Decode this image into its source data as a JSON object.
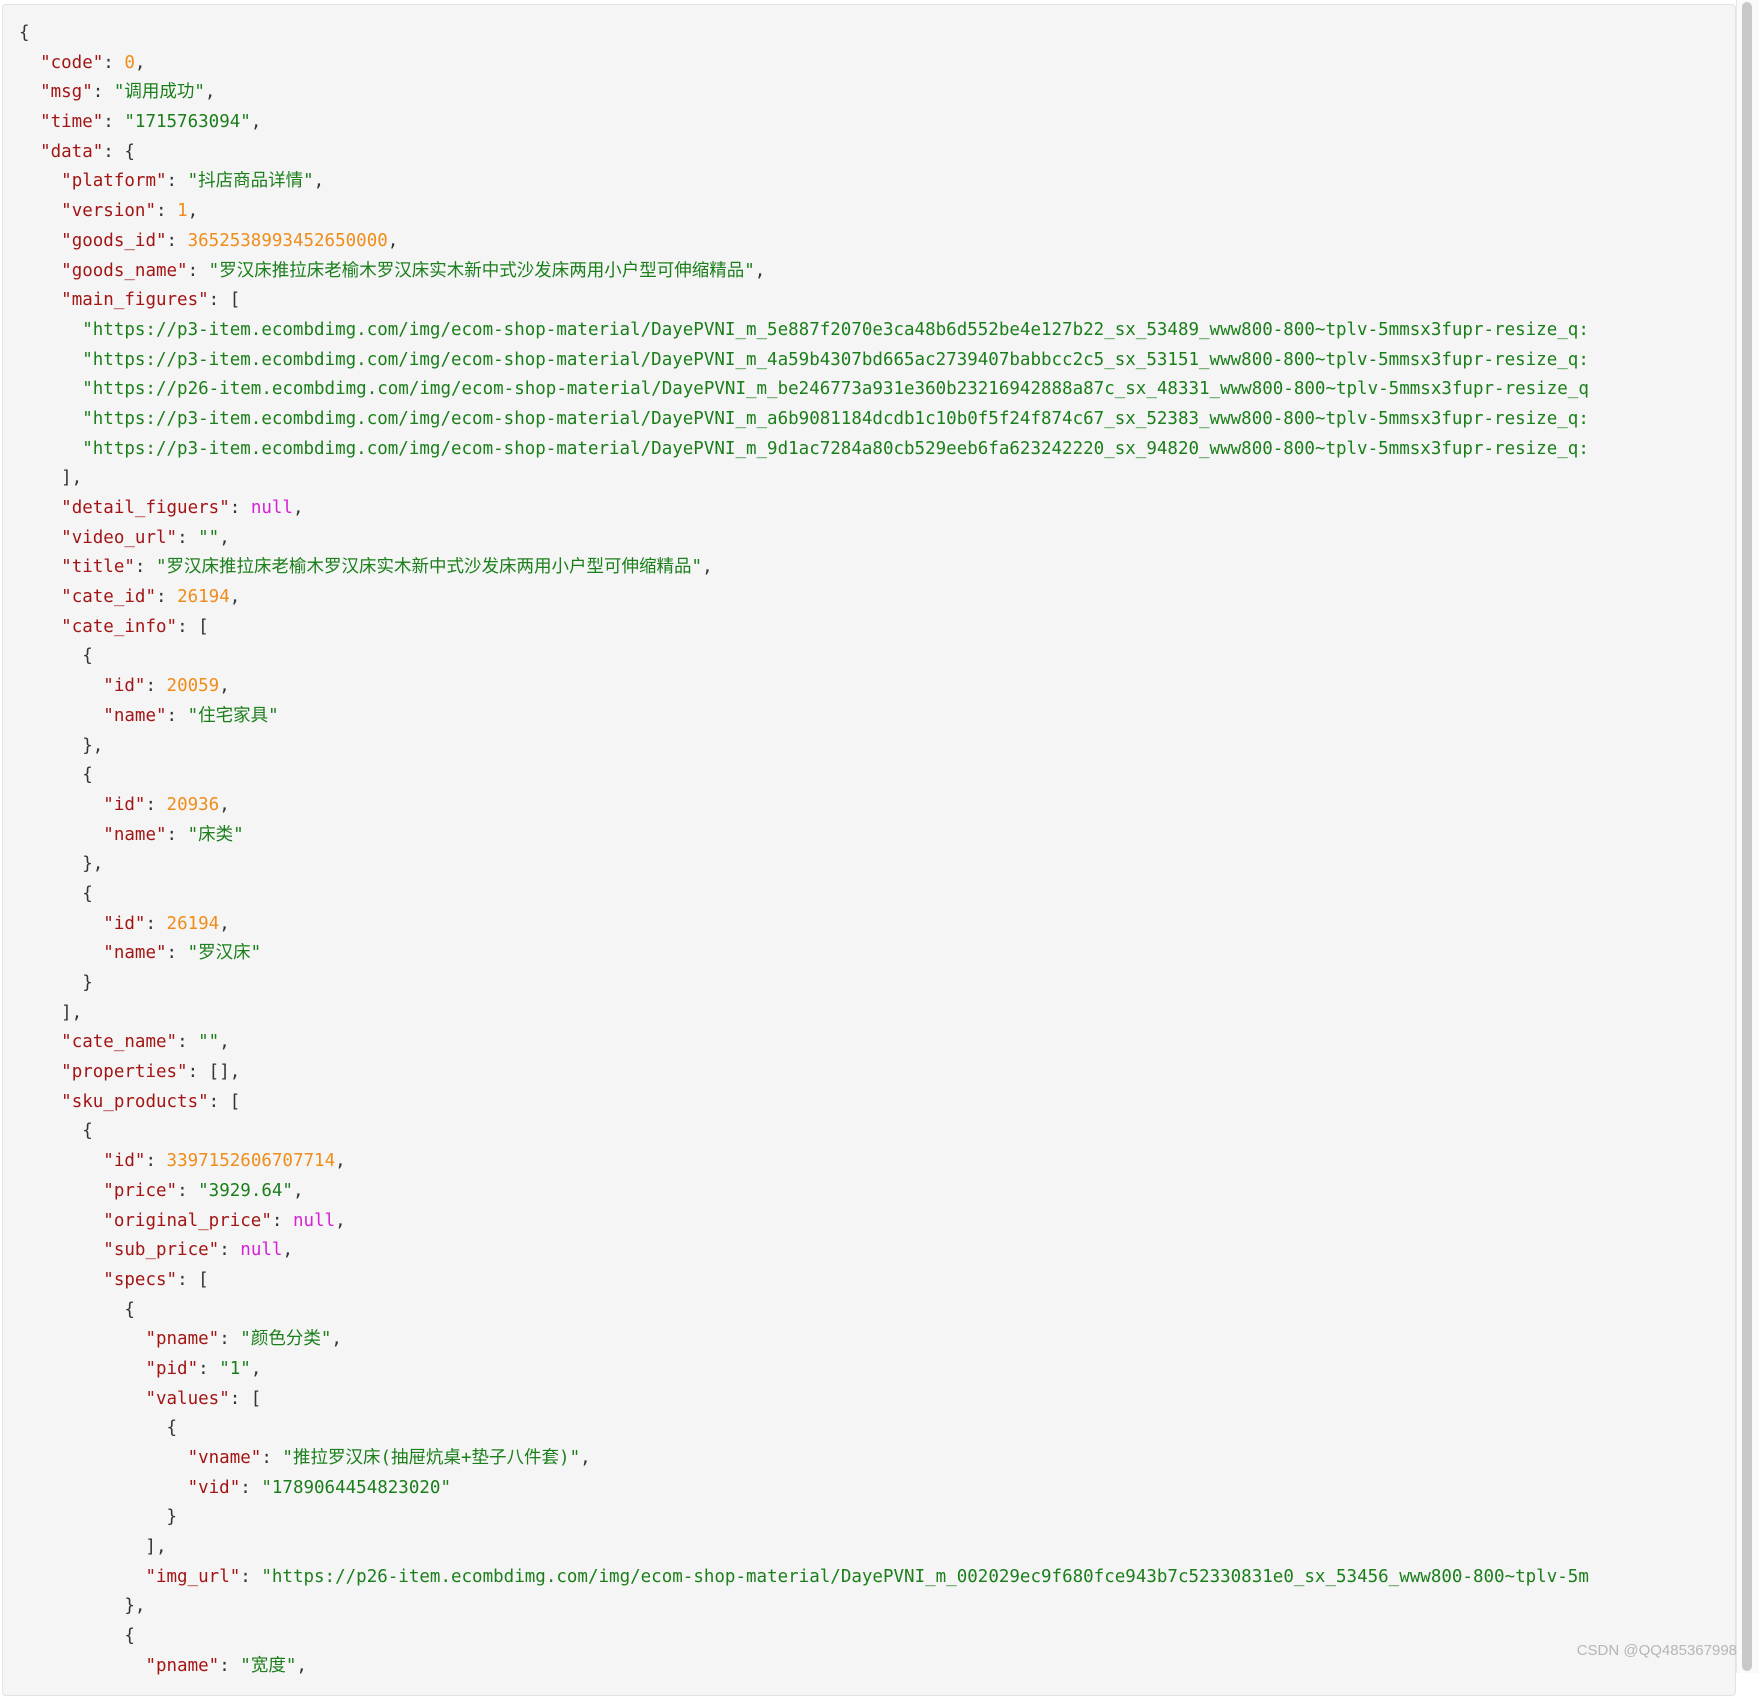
{
  "lines": [
    [
      {
        "t": "p",
        "v": "{"
      }
    ],
    [
      {
        "t": "p",
        "v": "  "
      },
      {
        "t": "k",
        "v": "\"code\""
      },
      {
        "t": "p",
        "v": ": "
      },
      {
        "t": "n",
        "v": "0"
      },
      {
        "t": "p",
        "v": ","
      }
    ],
    [
      {
        "t": "p",
        "v": "  "
      },
      {
        "t": "k",
        "v": "\"msg\""
      },
      {
        "t": "p",
        "v": ": "
      },
      {
        "t": "s",
        "v": "\"调用成功\""
      },
      {
        "t": "p",
        "v": ","
      }
    ],
    [
      {
        "t": "p",
        "v": "  "
      },
      {
        "t": "k",
        "v": "\"time\""
      },
      {
        "t": "p",
        "v": ": "
      },
      {
        "t": "s",
        "v": "\"1715763094\""
      },
      {
        "t": "p",
        "v": ","
      }
    ],
    [
      {
        "t": "p",
        "v": "  "
      },
      {
        "t": "k",
        "v": "\"data\""
      },
      {
        "t": "p",
        "v": ": {"
      }
    ],
    [
      {
        "t": "p",
        "v": "    "
      },
      {
        "t": "k",
        "v": "\"platform\""
      },
      {
        "t": "p",
        "v": ": "
      },
      {
        "t": "s",
        "v": "\"抖店商品详情\""
      },
      {
        "t": "p",
        "v": ","
      }
    ],
    [
      {
        "t": "p",
        "v": "    "
      },
      {
        "t": "k",
        "v": "\"version\""
      },
      {
        "t": "p",
        "v": ": "
      },
      {
        "t": "n",
        "v": "1"
      },
      {
        "t": "p",
        "v": ","
      }
    ],
    [
      {
        "t": "p",
        "v": "    "
      },
      {
        "t": "k",
        "v": "\"goods_id\""
      },
      {
        "t": "p",
        "v": ": "
      },
      {
        "t": "n",
        "v": "3652538993452650000"
      },
      {
        "t": "p",
        "v": ","
      }
    ],
    [
      {
        "t": "p",
        "v": "    "
      },
      {
        "t": "k",
        "v": "\"goods_name\""
      },
      {
        "t": "p",
        "v": ": "
      },
      {
        "t": "s",
        "v": "\"罗汉床推拉床老榆木罗汉床实木新中式沙发床两用小户型可伸缩精品\""
      },
      {
        "t": "p",
        "v": ","
      }
    ],
    [
      {
        "t": "p",
        "v": "    "
      },
      {
        "t": "k",
        "v": "\"main_figures\""
      },
      {
        "t": "p",
        "v": ": ["
      }
    ],
    [
      {
        "t": "p",
        "v": "      "
      },
      {
        "t": "s",
        "v": "\"https://p3-item.ecombdimg.com/img/ecom-shop-material/DayePVNI_m_5e887f2070e3ca48b6d552be4e127b22_sx_53489_www800-800~tplv-5mmsx3fupr-resize_q:"
      }
    ],
    [
      {
        "t": "p",
        "v": "      "
      },
      {
        "t": "s",
        "v": "\"https://p3-item.ecombdimg.com/img/ecom-shop-material/DayePVNI_m_4a59b4307bd665ac2739407babbcc2c5_sx_53151_www800-800~tplv-5mmsx3fupr-resize_q:"
      }
    ],
    [
      {
        "t": "p",
        "v": "      "
      },
      {
        "t": "s",
        "v": "\"https://p26-item.ecombdimg.com/img/ecom-shop-material/DayePVNI_m_be246773a931e360b23216942888a87c_sx_48331_www800-800~tplv-5mmsx3fupr-resize_q"
      }
    ],
    [
      {
        "t": "p",
        "v": "      "
      },
      {
        "t": "s",
        "v": "\"https://p3-item.ecombdimg.com/img/ecom-shop-material/DayePVNI_m_a6b9081184dcdb1c10b0f5f24f874c67_sx_52383_www800-800~tplv-5mmsx3fupr-resize_q:"
      }
    ],
    [
      {
        "t": "p",
        "v": "      "
      },
      {
        "t": "s",
        "v": "\"https://p3-item.ecombdimg.com/img/ecom-shop-material/DayePVNI_m_9d1ac7284a80cb529eeb6fa623242220_sx_94820_www800-800~tplv-5mmsx3fupr-resize_q:"
      }
    ],
    [
      {
        "t": "p",
        "v": "    ],"
      }
    ],
    [
      {
        "t": "p",
        "v": "    "
      },
      {
        "t": "k",
        "v": "\"detail_figuers\""
      },
      {
        "t": "p",
        "v": ": "
      },
      {
        "t": "l",
        "v": "null"
      },
      {
        "t": "p",
        "v": ","
      }
    ],
    [
      {
        "t": "p",
        "v": "    "
      },
      {
        "t": "k",
        "v": "\"video_url\""
      },
      {
        "t": "p",
        "v": ": "
      },
      {
        "t": "s",
        "v": "\"\""
      },
      {
        "t": "p",
        "v": ","
      }
    ],
    [
      {
        "t": "p",
        "v": "    "
      },
      {
        "t": "k",
        "v": "\"title\""
      },
      {
        "t": "p",
        "v": ": "
      },
      {
        "t": "s",
        "v": "\"罗汉床推拉床老榆木罗汉床实木新中式沙发床两用小户型可伸缩精品\""
      },
      {
        "t": "p",
        "v": ","
      }
    ],
    [
      {
        "t": "p",
        "v": "    "
      },
      {
        "t": "k",
        "v": "\"cate_id\""
      },
      {
        "t": "p",
        "v": ": "
      },
      {
        "t": "n",
        "v": "26194"
      },
      {
        "t": "p",
        "v": ","
      }
    ],
    [
      {
        "t": "p",
        "v": "    "
      },
      {
        "t": "k",
        "v": "\"cate_info\""
      },
      {
        "t": "p",
        "v": ": ["
      }
    ],
    [
      {
        "t": "p",
        "v": "      {"
      }
    ],
    [
      {
        "t": "p",
        "v": "        "
      },
      {
        "t": "k",
        "v": "\"id\""
      },
      {
        "t": "p",
        "v": ": "
      },
      {
        "t": "n",
        "v": "20059"
      },
      {
        "t": "p",
        "v": ","
      }
    ],
    [
      {
        "t": "p",
        "v": "        "
      },
      {
        "t": "k",
        "v": "\"name\""
      },
      {
        "t": "p",
        "v": ": "
      },
      {
        "t": "s",
        "v": "\"住宅家具\""
      }
    ],
    [
      {
        "t": "p",
        "v": "      },"
      }
    ],
    [
      {
        "t": "p",
        "v": "      {"
      }
    ],
    [
      {
        "t": "p",
        "v": "        "
      },
      {
        "t": "k",
        "v": "\"id\""
      },
      {
        "t": "p",
        "v": ": "
      },
      {
        "t": "n",
        "v": "20936"
      },
      {
        "t": "p",
        "v": ","
      }
    ],
    [
      {
        "t": "p",
        "v": "        "
      },
      {
        "t": "k",
        "v": "\"name\""
      },
      {
        "t": "p",
        "v": ": "
      },
      {
        "t": "s",
        "v": "\"床类\""
      }
    ],
    [
      {
        "t": "p",
        "v": "      },"
      }
    ],
    [
      {
        "t": "p",
        "v": "      {"
      }
    ],
    [
      {
        "t": "p",
        "v": "        "
      },
      {
        "t": "k",
        "v": "\"id\""
      },
      {
        "t": "p",
        "v": ": "
      },
      {
        "t": "n",
        "v": "26194"
      },
      {
        "t": "p",
        "v": ","
      }
    ],
    [
      {
        "t": "p",
        "v": "        "
      },
      {
        "t": "k",
        "v": "\"name\""
      },
      {
        "t": "p",
        "v": ": "
      },
      {
        "t": "s",
        "v": "\"罗汉床\""
      }
    ],
    [
      {
        "t": "p",
        "v": "      }"
      }
    ],
    [
      {
        "t": "p",
        "v": "    ],"
      }
    ],
    [
      {
        "t": "p",
        "v": "    "
      },
      {
        "t": "k",
        "v": "\"cate_name\""
      },
      {
        "t": "p",
        "v": ": "
      },
      {
        "t": "s",
        "v": "\"\""
      },
      {
        "t": "p",
        "v": ","
      }
    ],
    [
      {
        "t": "p",
        "v": "    "
      },
      {
        "t": "k",
        "v": "\"properties\""
      },
      {
        "t": "p",
        "v": ": [],"
      }
    ],
    [
      {
        "t": "p",
        "v": "    "
      },
      {
        "t": "k",
        "v": "\"sku_products\""
      },
      {
        "t": "p",
        "v": ": ["
      }
    ],
    [
      {
        "t": "p",
        "v": "      {"
      }
    ],
    [
      {
        "t": "p",
        "v": "        "
      },
      {
        "t": "k",
        "v": "\"id\""
      },
      {
        "t": "p",
        "v": ": "
      },
      {
        "t": "n",
        "v": "3397152606707714"
      },
      {
        "t": "p",
        "v": ","
      }
    ],
    [
      {
        "t": "p",
        "v": "        "
      },
      {
        "t": "k",
        "v": "\"price\""
      },
      {
        "t": "p",
        "v": ": "
      },
      {
        "t": "s",
        "v": "\"3929.64\""
      },
      {
        "t": "p",
        "v": ","
      }
    ],
    [
      {
        "t": "p",
        "v": "        "
      },
      {
        "t": "k",
        "v": "\"original_price\""
      },
      {
        "t": "p",
        "v": ": "
      },
      {
        "t": "l",
        "v": "null"
      },
      {
        "t": "p",
        "v": ","
      }
    ],
    [
      {
        "t": "p",
        "v": "        "
      },
      {
        "t": "k",
        "v": "\"sub_price\""
      },
      {
        "t": "p",
        "v": ": "
      },
      {
        "t": "l",
        "v": "null"
      },
      {
        "t": "p",
        "v": ","
      }
    ],
    [
      {
        "t": "p",
        "v": "        "
      },
      {
        "t": "k",
        "v": "\"specs\""
      },
      {
        "t": "p",
        "v": ": ["
      }
    ],
    [
      {
        "t": "p",
        "v": "          {"
      }
    ],
    [
      {
        "t": "p",
        "v": "            "
      },
      {
        "t": "k",
        "v": "\"pname\""
      },
      {
        "t": "p",
        "v": ": "
      },
      {
        "t": "s",
        "v": "\"颜色分类\""
      },
      {
        "t": "p",
        "v": ","
      }
    ],
    [
      {
        "t": "p",
        "v": "            "
      },
      {
        "t": "k",
        "v": "\"pid\""
      },
      {
        "t": "p",
        "v": ": "
      },
      {
        "t": "s",
        "v": "\"1\""
      },
      {
        "t": "p",
        "v": ","
      }
    ],
    [
      {
        "t": "p",
        "v": "            "
      },
      {
        "t": "k",
        "v": "\"values\""
      },
      {
        "t": "p",
        "v": ": ["
      }
    ],
    [
      {
        "t": "p",
        "v": "              {"
      }
    ],
    [
      {
        "t": "p",
        "v": "                "
      },
      {
        "t": "k",
        "v": "\"vname\""
      },
      {
        "t": "p",
        "v": ": "
      },
      {
        "t": "s",
        "v": "\"推拉罗汉床(抽屉炕桌+垫子八件套)\""
      },
      {
        "t": "p",
        "v": ","
      }
    ],
    [
      {
        "t": "p",
        "v": "                "
      },
      {
        "t": "k",
        "v": "\"vid\""
      },
      {
        "t": "p",
        "v": ": "
      },
      {
        "t": "s",
        "v": "\"1789064454823020\""
      }
    ],
    [
      {
        "t": "p",
        "v": "              }"
      }
    ],
    [
      {
        "t": "p",
        "v": "            ],"
      }
    ],
    [
      {
        "t": "p",
        "v": "            "
      },
      {
        "t": "k",
        "v": "\"img_url\""
      },
      {
        "t": "p",
        "v": ": "
      },
      {
        "t": "s",
        "v": "\"https://p26-item.ecombdimg.com/img/ecom-shop-material/DayePVNI_m_002029ec9f680fce943b7c52330831e0_sx_53456_www800-800~tplv-5m"
      }
    ],
    [
      {
        "t": "p",
        "v": "          },"
      }
    ],
    [
      {
        "t": "p",
        "v": "          {"
      }
    ],
    [
      {
        "t": "p",
        "v": "            "
      },
      {
        "t": "k",
        "v": "\"pname\""
      },
      {
        "t": "p",
        "v": ": "
      },
      {
        "t": "s",
        "v": "\"宽度\""
      },
      {
        "t": "p",
        "v": ","
      }
    ]
  ],
  "watermark": "CSDN @QQ485367998",
  "colors": {
    "key": "#a31515",
    "string": "#1a7f1a",
    "number": "#f08c1a",
    "literal": "#d61fd6",
    "punct": "#333333",
    "panel": "#f5f5f5"
  }
}
